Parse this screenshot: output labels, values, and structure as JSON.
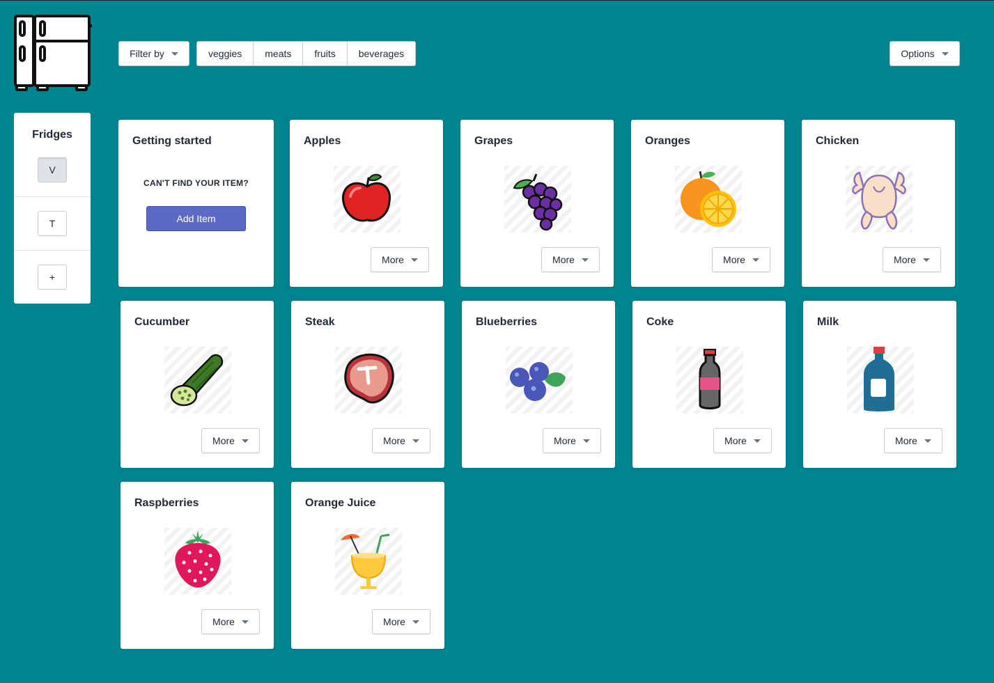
{
  "header": {
    "filter_label": "Filter by",
    "segments": [
      "veggies",
      "meats",
      "fruits",
      "beverages"
    ],
    "options_label": "Options"
  },
  "sidebar": {
    "title": "Fridges",
    "fridges": [
      "V",
      "T"
    ],
    "add_label": "+"
  },
  "getting_started": {
    "title": "Getting started",
    "prompt": "CAN'T FIND YOUR ITEM?",
    "add_label": "Add Item"
  },
  "more_label": "More",
  "items": [
    {
      "name": "Apples",
      "icon": "apple-icon"
    },
    {
      "name": "Grapes",
      "icon": "grapes-icon"
    },
    {
      "name": "Oranges",
      "icon": "orange-icon"
    },
    {
      "name": "Chicken",
      "icon": "chicken-icon"
    },
    {
      "name": "Cucumber",
      "icon": "cucumber-icon"
    },
    {
      "name": "Steak",
      "icon": "steak-icon"
    },
    {
      "name": "Blueberries",
      "icon": "blueberries-icon"
    },
    {
      "name": "Coke",
      "icon": "coke-bottle-icon"
    },
    {
      "name": "Milk",
      "icon": "milk-bottle-icon"
    },
    {
      "name": "Raspberries",
      "icon": "raspberry-icon"
    },
    {
      "name": "Orange Juice",
      "icon": "orange-juice-icon"
    }
  ],
  "colors": {
    "background": "#00848E",
    "primary": "#5C6AC4"
  }
}
